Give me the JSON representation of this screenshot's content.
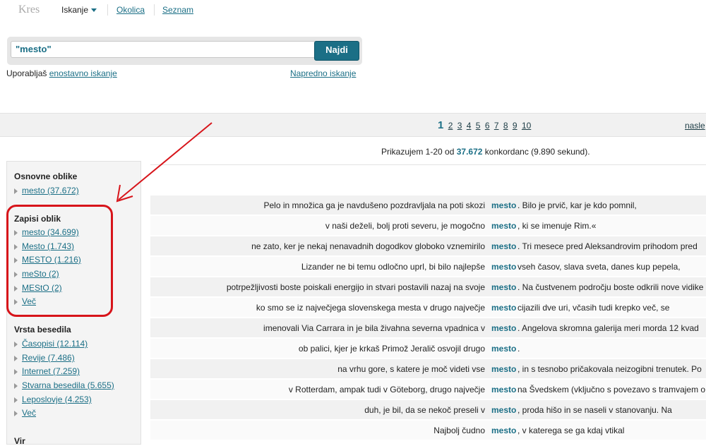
{
  "topnav": {
    "logo": "Kres",
    "iskanje": "Iskanje",
    "okolica": "Okolica",
    "seznam": "Seznam"
  },
  "search": {
    "value": "\"mesto\"",
    "button": "Najdi",
    "simple_prefix": "Uporabljaš",
    "simple_link": "enostavno iskanje",
    "advanced_link": "Napredno iskanje"
  },
  "pager": {
    "current": "1",
    "pages": [
      "2",
      "3",
      "4",
      "5",
      "6",
      "7",
      "8",
      "9",
      "10"
    ],
    "next": "nasle"
  },
  "summary": {
    "prefix": "Prikazujem 1-20 od",
    "count": "37.672",
    "suffix": "konkordanc (9.890 sekund)."
  },
  "sidebar": {
    "sections": [
      {
        "title": "Osnovne oblike",
        "items": [
          "mesto (37.672)"
        ]
      },
      {
        "title": "Zapisi oblik",
        "items": [
          "mesto (34.699)",
          "Mesto (1.743)",
          "MESTO (1.216)",
          "meSto (2)",
          "MEStO (2)",
          "Več"
        ]
      },
      {
        "title": "Vrsta besedila",
        "items": [
          "Časopisi (12.114)",
          "Revije (7.486)",
          "Internet (7.259)",
          "Stvarna besedila (5.655)",
          "Leposlovje (4.253)",
          "Več"
        ]
      },
      {
        "title": "Vir",
        "items": []
      }
    ]
  },
  "keyword": "mesto",
  "concordances": [
    {
      "left": "Pelo in množica ga je navdušeno pozdravljala na poti skozi",
      "right": ". Bilo je prvič, kar je kdo pomnil,"
    },
    {
      "left": "v naši deželi, bolj proti severu, je mogočno",
      "right": ", ki se imenuje Rim.«"
    },
    {
      "left": "ne zato, ker je nekaj nenavadnih dogodkov globoko vznemirilo",
      "right": ". Tri mesece pred Aleksandrovim prihodom pred"
    },
    {
      "left": "Lizander ne bi temu odločno uprl, bi bilo najlepše",
      "right": "vseh časov, slava sveta, danes kup pepela,"
    },
    {
      "left": "potrpežljivosti boste poiskali energijo in stvari postavili nazaj na svoje",
      "right": ". Na čustvenem področju boste odkrili nove vidike"
    },
    {
      "left": "ko smo se iz največjega slovenskega mesta v drugo največje",
      "right": "cijazili dve uri, včasih tudi krepko več, se"
    },
    {
      "left": "imenovali Via Carrara in je bila živahna severna vpadnica v",
      "right": ". Angelova skromna galerija meri morda 12 kvad"
    },
    {
      "left": "ob palici, kjer je krkaš Primož Jeralič osvojil drugo",
      "right": "."
    },
    {
      "left": "na vrhu gore, s katere je moč videti vse",
      "right": ", in s tesnobo pričakovala neizogibni trenutek. Po"
    },
    {
      "left": "v Rotterdam, ampak tudi v Göteborg, drugo največje",
      "right": "na Švedskem (vključno s povezavo s tramvajem o"
    },
    {
      "left": "duh, je bil, da se nekoč preseli v",
      "right": ", proda hišo in se naseli v stanovanju. Na"
    },
    {
      "left": "Najbolj čudno",
      "right": ", v katerega se ga kdaj vtikal"
    }
  ]
}
